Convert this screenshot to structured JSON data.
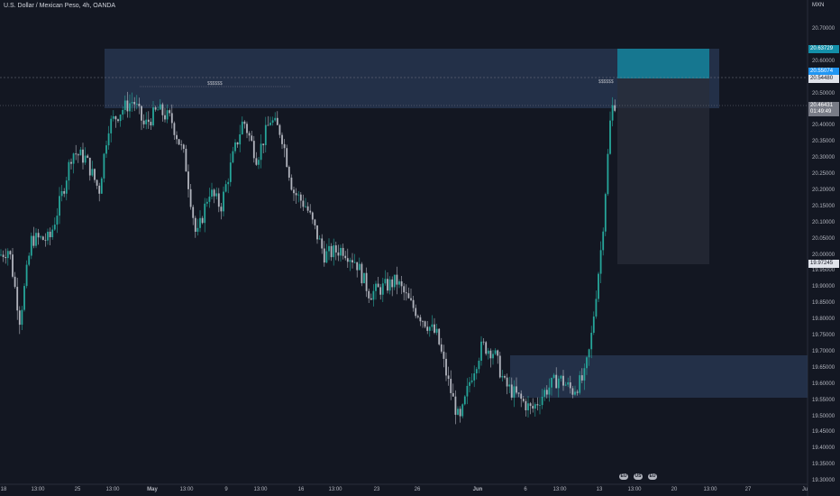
{
  "header": {
    "title": "U.S. Dollar / Mexican Peso, 4h, OANDA",
    "currency": "MXN"
  },
  "price_axis": {
    "ticks": [
      "20.70000",
      "20.60000",
      "20.50000",
      "20.40000",
      "20.35000",
      "20.30000",
      "20.25000",
      "20.20000",
      "20.15000",
      "20.10000",
      "20.05000",
      "20.00000",
      "19.95000",
      "19.90000",
      "19.85000",
      "19.80000",
      "19.75000",
      "19.70000",
      "19.65000",
      "19.60000",
      "19.55000",
      "19.50000",
      "19.45000",
      "19.40000",
      "19.35000",
      "19.30000"
    ],
    "tick_values": [
      20.7,
      20.6,
      20.5,
      20.4,
      20.35,
      20.3,
      20.25,
      20.2,
      20.15,
      20.1,
      20.05,
      20.0,
      19.95,
      19.9,
      19.85,
      19.8,
      19.75,
      19.7,
      19.65,
      19.6,
      19.55,
      19.5,
      19.45,
      19.4,
      19.35,
      19.3
    ]
  },
  "badges": {
    "target_top": "20.63729",
    "target_low": "20.55074",
    "level_dashed": "20.54480",
    "current_price": "20.46431",
    "countdown": "01:49:49",
    "stop_level": "19.97245"
  },
  "levels": {
    "target_top": 20.637,
    "target_low": 20.551,
    "dashed": 20.545,
    "current": 20.464,
    "stop": 19.972,
    "colors": {
      "current": "#787b86",
      "target": "#2196f3",
      "stop": "#363a45"
    }
  },
  "annotations": {
    "liquidity_left": "$$$$$$",
    "liquidity_right": "$$$$$$"
  },
  "time_axis": {
    "labels": [
      "18",
      "13:00",
      "25",
      "13:00",
      "May",
      "13:00",
      "9",
      "13:00",
      "16",
      "13:00",
      "23",
      "26",
      "Jun",
      "6",
      "13:00",
      "13",
      "13:00",
      "20",
      "13:00",
      "27",
      "Ju"
    ]
  },
  "events": [
    "EU",
    "US",
    "EU"
  ],
  "colors": {
    "background": "#131722",
    "up": "#26a69a",
    "down": "#b2b5be",
    "zone": "#2a3a55",
    "target_zone": "#138fa8"
  }
}
